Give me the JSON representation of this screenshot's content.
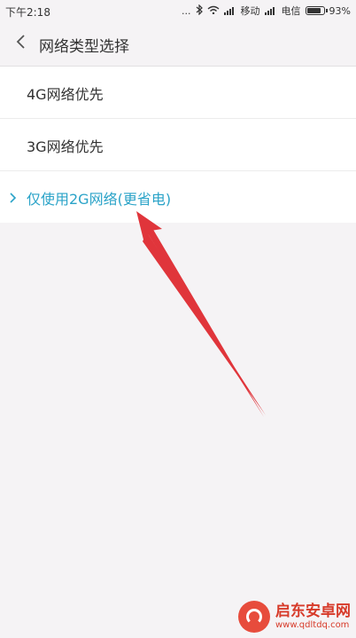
{
  "status": {
    "time": "下午2:18",
    "dots": "...",
    "carrier1": "移动",
    "carrier2": "电信",
    "battery": "93%",
    "battery_level": 0.93
  },
  "header": {
    "title": "网络类型选择"
  },
  "options": [
    {
      "label": "4G网络优先",
      "selected": false
    },
    {
      "label": "3G网络优先",
      "selected": false
    },
    {
      "label": "仅使用2G网络(更省电)",
      "selected": true
    }
  ],
  "colors": {
    "accent": "#2aa3c8",
    "annotation_arrow": "#e0353b",
    "background": "#f5f3f5"
  },
  "watermark": {
    "name": "启东安卓网",
    "url": "www.qdltdq.com"
  }
}
